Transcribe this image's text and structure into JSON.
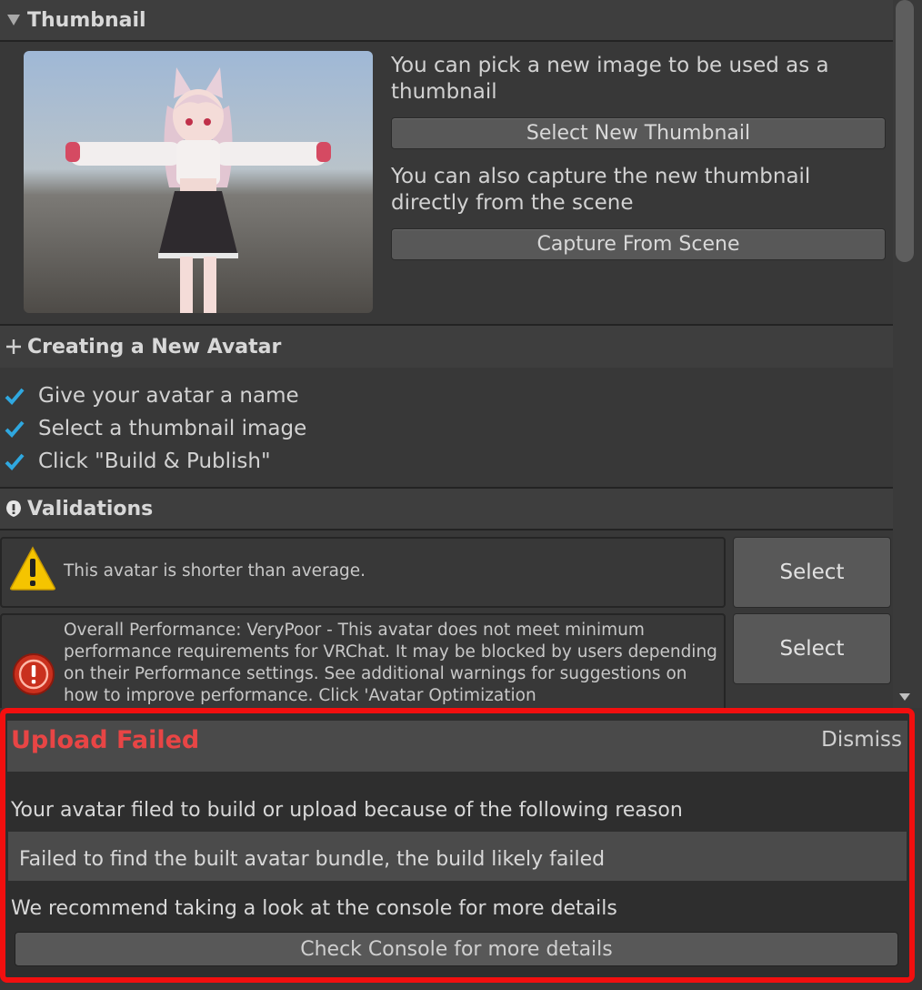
{
  "thumbnail": {
    "header": "Thumbnail",
    "pick_text": "You can pick a new image to be used as a thumbnail",
    "select_button": "Select New Thumbnail",
    "capture_text": "You can also capture the new thumbnail directly from the scene",
    "capture_button": "Capture From Scene"
  },
  "creating": {
    "header": "Creating a New Avatar",
    "steps": [
      "Give your avatar a name",
      "Select a thumbnail image",
      "Click \"Build & Publish\""
    ]
  },
  "validations": {
    "header": "Validations",
    "items": [
      {
        "text": "This avatar is shorter than average.",
        "button": "Select",
        "severity": "warning"
      },
      {
        "text": "Overall Performance: VeryPoor - This avatar does not meet minimum performance requirements for VRChat. It may be blocked by users depending on their Performance settings. See additional warnings for suggestions on how to improve performance. Click 'Avatar Optimization",
        "button": "Select",
        "severity": "error"
      }
    ]
  },
  "upload_error": {
    "title": "Upload Failed",
    "dismiss": "Dismiss",
    "intro": "Your avatar filed to build or upload because of the following reason",
    "reason": "Failed to find the built avatar bundle, the build likely failed",
    "recommend": "We recommend taking a look at the console for more details",
    "console_button": "Check Console for more details"
  },
  "colors": {
    "error_red": "#f20f0f",
    "title_red": "#e84545",
    "check_blue": "#2fa8e0",
    "warning_yellow": "#f5c400"
  }
}
